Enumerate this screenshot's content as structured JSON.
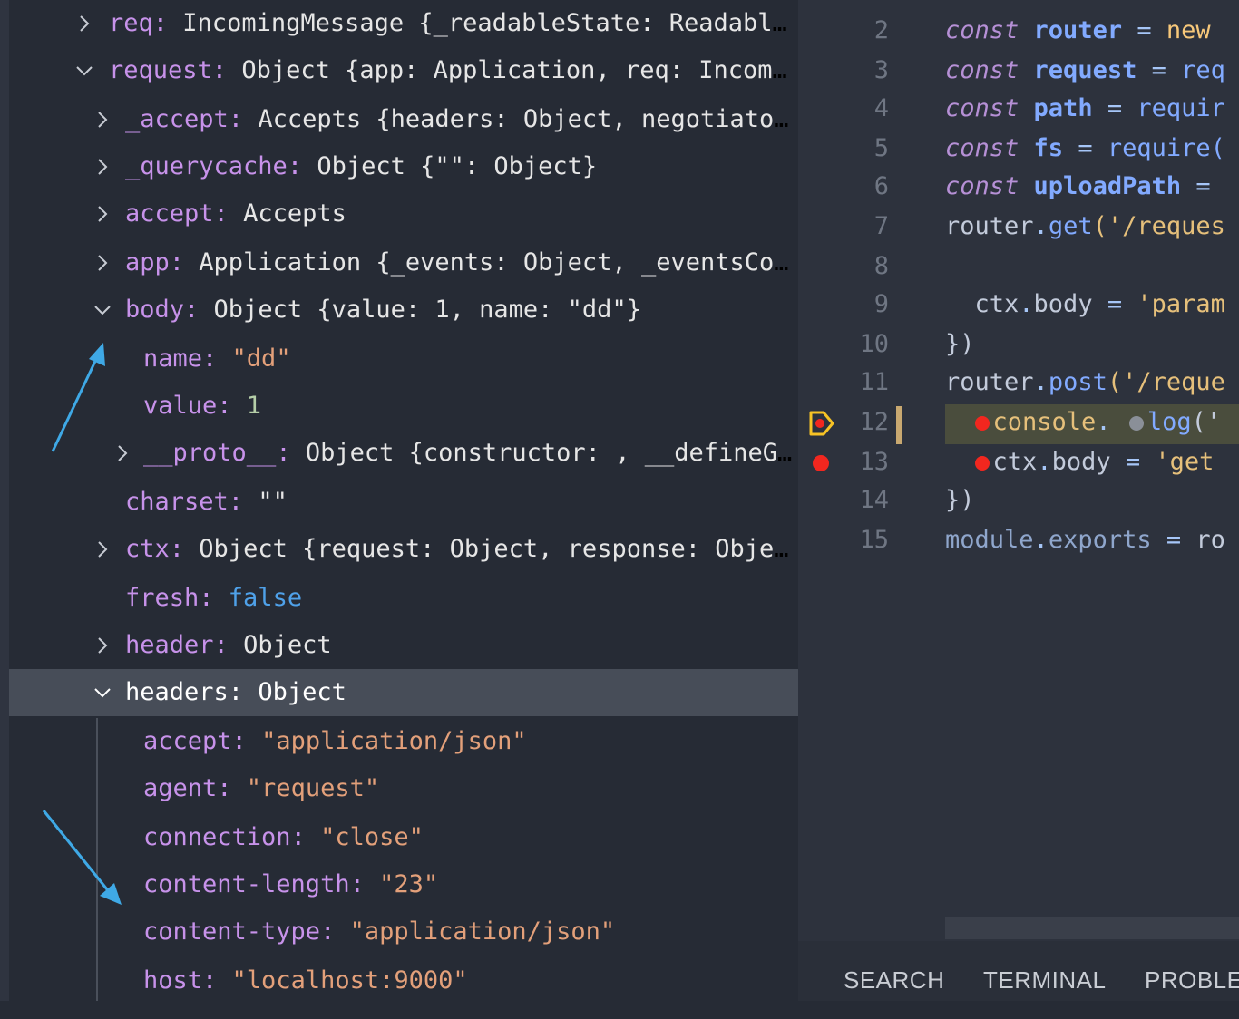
{
  "variables": [
    {
      "key": "req",
      "sep": ": ",
      "value": "IncomingMessage {_readableState: ReadableS…",
      "vtype": "plain",
      "expander": "collapsed"
    },
    {
      "key": "request",
      "sep": ": ",
      "value": "Object {app: Application, req: Incomin…",
      "vtype": "plain",
      "expander": "expanded"
    },
    {
      "key": "_accept",
      "sep": ": ",
      "value": "Accepts {headers: Object, negotiator…",
      "vtype": "plain",
      "expander": "collapsed"
    },
    {
      "key": "_querycache",
      "sep": ": ",
      "value": "Object {\"\": Object}",
      "vtype": "plain",
      "expander": "collapsed"
    },
    {
      "key": "accept",
      "sep": ": ",
      "value": "Accepts",
      "vtype": "plain",
      "expander": "collapsed"
    },
    {
      "key": "app",
      "sep": ": ",
      "value": "Application {_events: Object, _eventsCou…",
      "vtype": "plain",
      "expander": "collapsed"
    },
    {
      "key": "body",
      "sep": ": ",
      "value": "Object {value: 1, name: \"dd\"}",
      "vtype": "plain",
      "expander": "expanded"
    },
    {
      "key": "name",
      "sep": ": ",
      "value": "\"dd\"",
      "vtype": "string",
      "expander": "none"
    },
    {
      "key": "value",
      "sep": ": ",
      "value": "1",
      "vtype": "number",
      "expander": "none"
    },
    {
      "key": "__proto__",
      "sep": ": ",
      "value": "Object {constructor: , __defineGe…",
      "vtype": "plain",
      "expander": "collapsed"
    },
    {
      "key": "charset",
      "sep": ": ",
      "value": "\"\"",
      "vtype": "plain",
      "expander": "none"
    },
    {
      "key": "ctx",
      "sep": ": ",
      "value": "Object {request: Object, response: Objec…",
      "vtype": "plain",
      "expander": "collapsed"
    },
    {
      "key": "fresh",
      "sep": ": ",
      "value": "false",
      "vtype": "boolean",
      "expander": "none"
    },
    {
      "key": "header",
      "sep": ": ",
      "value": "Object",
      "vtype": "plain",
      "expander": "collapsed"
    },
    {
      "key": "headers",
      "sep": ": ",
      "value": "Object",
      "vtype": "plain",
      "expander": "expanded",
      "selected": true
    },
    {
      "key": "accept",
      "sep": ": ",
      "value": "\"application/json\"",
      "vtype": "string",
      "expander": "none"
    },
    {
      "key": "agent",
      "sep": ": ",
      "value": "\"request\"",
      "vtype": "string",
      "expander": "none"
    },
    {
      "key": "connection",
      "sep": ": ",
      "value": "\"close\"",
      "vtype": "string",
      "expander": "none"
    },
    {
      "key": "content-length",
      "sep": ": ",
      "value": "\"23\"",
      "vtype": "string",
      "expander": "none"
    },
    {
      "key": "content-type",
      "sep": ": ",
      "value": "\"application/json\"",
      "vtype": "string",
      "expander": "none"
    },
    {
      "key": "host",
      "sep": ": ",
      "value": "\"localhost:9000\"",
      "vtype": "string",
      "expander": "none"
    }
  ],
  "editor": {
    "line_numbers": [
      "2",
      "3",
      "4",
      "5",
      "6",
      "7",
      "8",
      "9",
      "10",
      "11",
      "12",
      "13",
      "14",
      "15"
    ],
    "lines": {
      "l2": {
        "kw": "const",
        "id": "router",
        "op": " = ",
        "rest": "new"
      },
      "l3": {
        "kw": "const",
        "id": "request",
        "op": " = ",
        "rest": "req"
      },
      "l4": {
        "kw": "const",
        "id": "path",
        "op": " = ",
        "rest": "requir"
      },
      "l5": {
        "kw": "const",
        "id": "fs",
        "op": " = ",
        "rest": "require("
      },
      "l6": {
        "kw": "const",
        "id": "uploadPath",
        "op": " = ",
        "rest": ""
      },
      "l7": {
        "obj": "router",
        "dot": ".",
        "fn": "get",
        "rest": "('/reques"
      },
      "l9": {
        "obj": "  ctx",
        "dot": ".",
        "prop": "body",
        "op": " = ",
        "str": "'param"
      },
      "l10": {
        "text": "})"
      },
      "l11": {
        "obj": "router",
        "dot": ".",
        "fn": "post",
        "rest": "('/reque"
      },
      "l12": {
        "obj": "console",
        "dot": ".",
        "fn": "log",
        "rest": "('"
      },
      "l13": {
        "obj": "ctx",
        "dot": ".",
        "prop": "body",
        "op": " = ",
        "str": "'get"
      },
      "l14": {
        "text": "})"
      },
      "l15": {
        "obj": "module",
        "dot": ".",
        "fn": "exports",
        "op": " = ",
        "rest": "ro"
      }
    }
  },
  "panel_tabs": [
    "SEARCH",
    "TERMINAL",
    "PROBLE"
  ],
  "colors": {
    "breakpoint": "#f2271f",
    "paused": "#f7c325",
    "annotation_arrow": "#3fa9e6"
  }
}
